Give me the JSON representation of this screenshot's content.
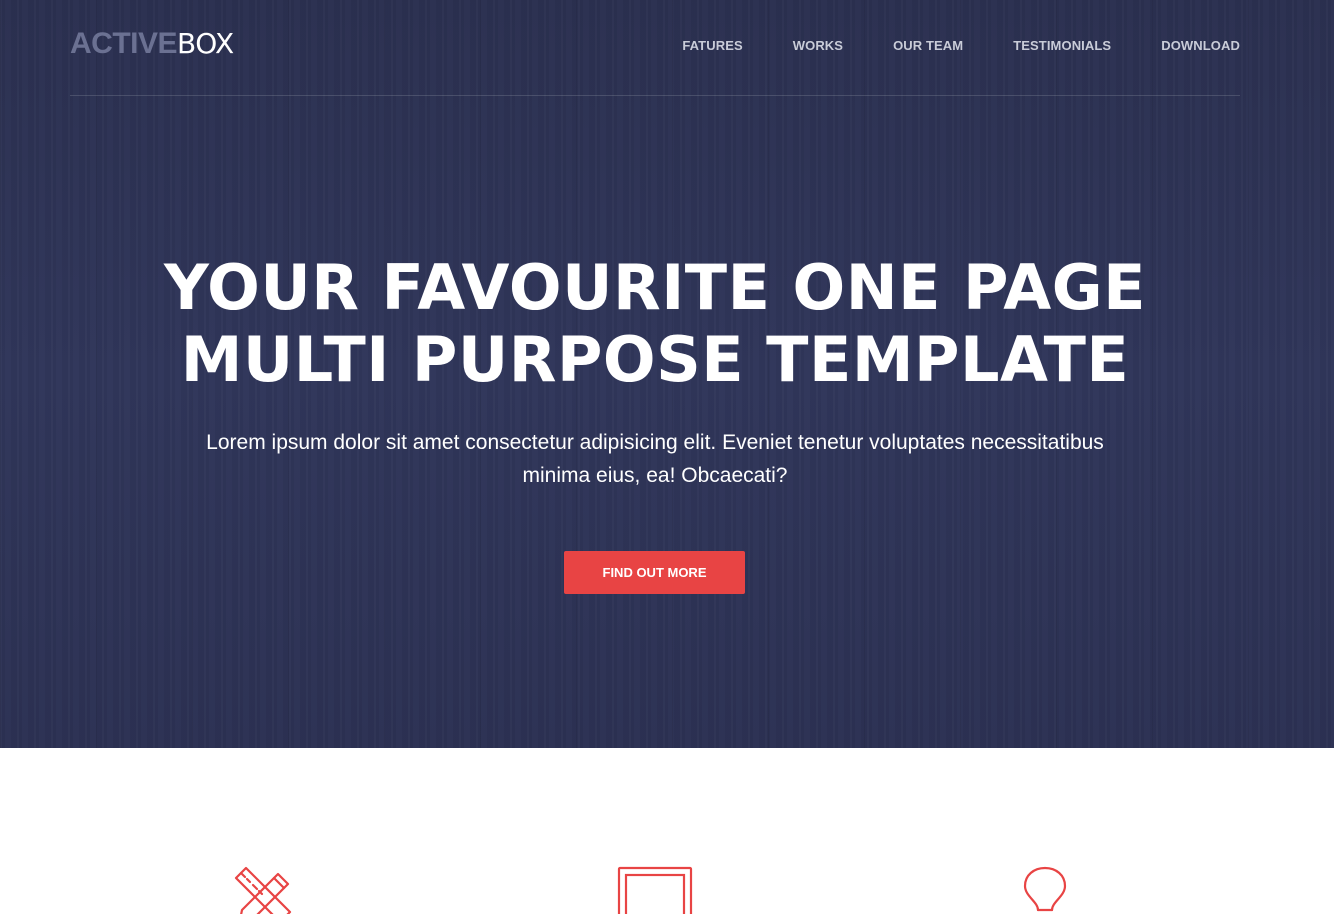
{
  "brand": {
    "logo_strong": "ACTIVE",
    "logo_light": "BOX"
  },
  "nav": {
    "items": [
      {
        "label": "FATURES"
      },
      {
        "label": "WORKS"
      },
      {
        "label": "OUR TEAM"
      },
      {
        "label": "TESTIMONIALS"
      },
      {
        "label": "DOWNLOAD"
      }
    ]
  },
  "hero": {
    "headline_line1": "YOUR FAVOURITE ONE PAGE",
    "headline_line2": "MULTI PURPOSE TEMPLATE",
    "lead": "Lorem ipsum dolor sit amet consectetur adipisicing elit. Eveniet tenetur voluptates necessitatibus minima eius, ea! Obcaecati?",
    "cta_label": "FIND OUT MORE"
  },
  "features": {
    "icons": [
      "design-tools-icon",
      "screen-icon",
      "lightbulb-icon"
    ]
  },
  "colors": {
    "hero_bg": "#2e3352",
    "accent": "#e84444",
    "nav_text": "#c9ccd8",
    "logo_strong": "#6b7192"
  }
}
